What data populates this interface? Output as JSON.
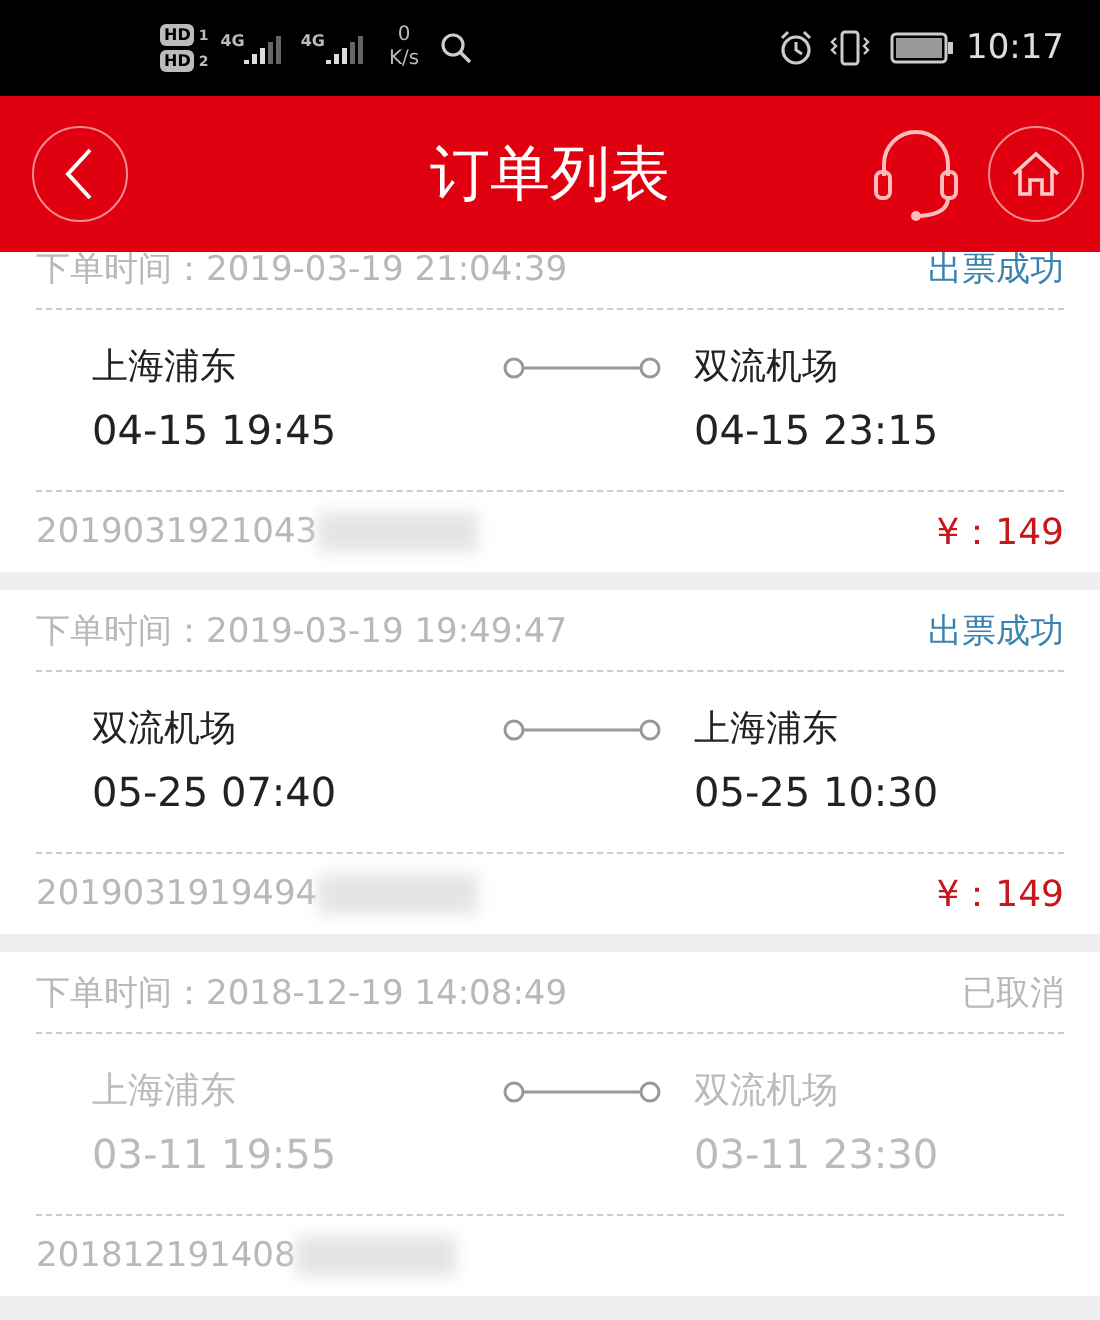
{
  "status_bar": {
    "sims": [
      {
        "label": "HD",
        "slot": "1"
      },
      {
        "label": "HD",
        "slot": "2"
      }
    ],
    "networks": [
      "4G",
      "4G"
    ],
    "speed_value": "0",
    "speed_unit": "K/s",
    "time": "10:17"
  },
  "header": {
    "title": "订单列表"
  },
  "orders": [
    {
      "order_time_label": "下单时间：",
      "order_time": "2019-03-19 21:04:39",
      "status": "出票成功",
      "cancelled": false,
      "from": "上海浦东",
      "depart": "04-15 19:45",
      "to": "双流机场",
      "arrive": "04-15 23:15",
      "order_no": "2019031921043",
      "price": "¥：149"
    },
    {
      "order_time_label": "下单时间：",
      "order_time": "2019-03-19 19:49:47",
      "status": "出票成功",
      "cancelled": false,
      "from": "双流机场",
      "depart": "05-25 07:40",
      "to": "上海浦东",
      "arrive": "05-25 10:30",
      "order_no": "2019031919494",
      "price": "¥：149"
    },
    {
      "order_time_label": "下单时间：",
      "order_time": "2018-12-19 14:08:49",
      "status": "已取消",
      "cancelled": true,
      "from": "上海浦东",
      "depart": "03-11 19:55",
      "to": "双流机场",
      "arrive": "03-11 23:30",
      "order_no": "201812191408"
    }
  ]
}
